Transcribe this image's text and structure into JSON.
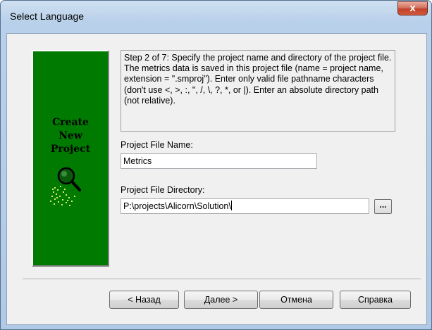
{
  "window": {
    "title": "Select Language",
    "close_glyph": "x"
  },
  "banner": {
    "line1": "Create",
    "line2": "New",
    "line3": "Project",
    "icon": "magnifier-icon",
    "background": "#007a00"
  },
  "description": "Step 2 of 7: Specify the project name and directory of the project file. The metrics data is saved in this project file (name = project name, extension = \".smproj\"). Enter only valid file pathname characters (don't use <, >, :, \", /, \\, ?, *, or |). Enter an absolute directory path (not relative).",
  "project_name": {
    "label": "Project File Name:",
    "value": "Metrics"
  },
  "project_dir": {
    "label": "Project File Directory:",
    "value": "P:\\projects\\Alicorn\\Solution\\",
    "browse_label": "..."
  },
  "buttons": {
    "back": "< Назад",
    "next": "Далее >",
    "cancel": "Отмена",
    "help": "Справка"
  }
}
